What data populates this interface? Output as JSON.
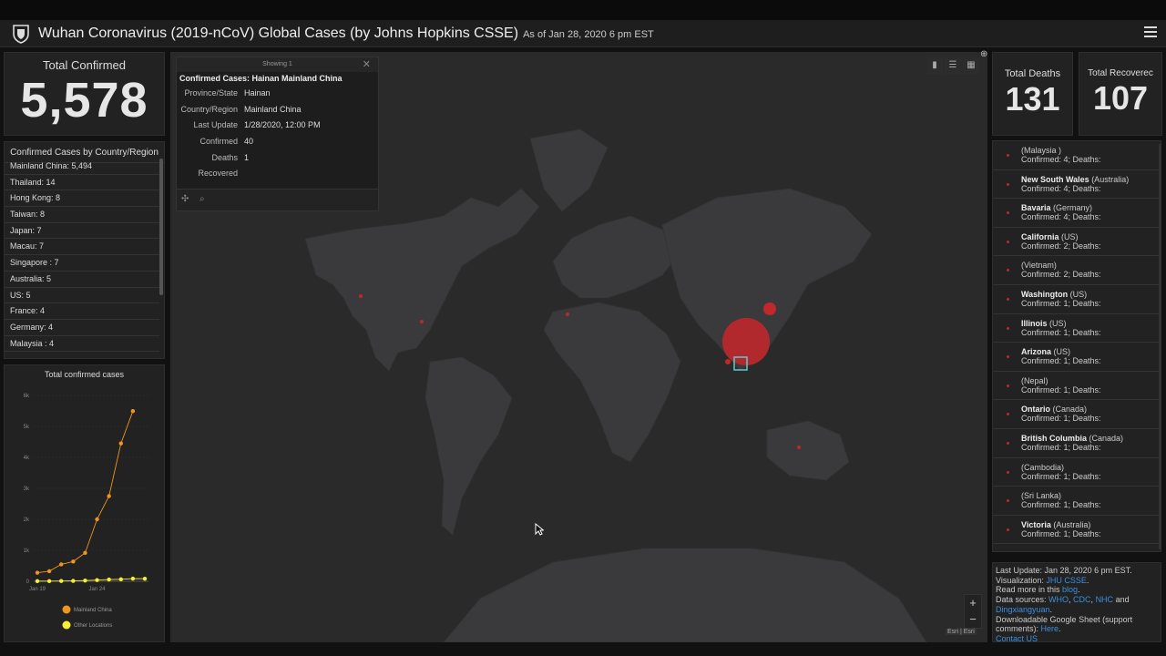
{
  "header": {
    "title": "Wuhan Coronavirus (2019-nCoV) Global Cases (by Johns Hopkins CSSE)",
    "as_of": "As of Jan 28, 2020 6 pm EST"
  },
  "total_confirmed": {
    "label": "Total Confirmed",
    "value": "5,578"
  },
  "country_list": {
    "title": "Confirmed Cases by Country/Region",
    "rows": [
      "Mainland China:  5,494",
      "Thailand:  14",
      "Hong Kong:  8",
      "Taiwan:  8",
      "Japan:  7",
      "Macau:  7",
      "Singapore :  7",
      "Australia:  5",
      "US:  5",
      "France:  4",
      "Germany:  4",
      "Malaysia :  4"
    ]
  },
  "popup": {
    "showing": "Showing 1",
    "title": "Confirmed Cases: Hainan Mainland China",
    "rows": [
      {
        "key": "Province/State",
        "value": "Hainan"
      },
      {
        "key": "Country/Region",
        "value": "Mainland China"
      },
      {
        "key": "Last Update",
        "value": "1/28/2020, 12:00 PM"
      },
      {
        "key": "Confirmed",
        "value": "40"
      },
      {
        "key": "Deaths",
        "value": "1"
      },
      {
        "key": "Recovered",
        "value": ""
      }
    ]
  },
  "map": {
    "zoom_in": "+",
    "zoom_out": "−",
    "attribution": "Esri | Esri"
  },
  "deaths": {
    "label": "Total Deaths",
    "value": "131"
  },
  "recovered": {
    "label": "Total Recoverec",
    "value": "107"
  },
  "locations": [
    {
      "name": "",
      "region": "(Malaysia )",
      "detail": "Confirmed: 4; Deaths:"
    },
    {
      "name": "New South Wales",
      "region": " (Australia)",
      "detail": "Confirmed: 4; Deaths:"
    },
    {
      "name": "Bavaria",
      "region": " (Germany)",
      "detail": "Confirmed: 4; Deaths:"
    },
    {
      "name": "California",
      "region": " (US)",
      "detail": "Confirmed: 2; Deaths:"
    },
    {
      "name": "",
      "region": "(Vietnam)",
      "detail": "Confirmed: 2; Deaths:"
    },
    {
      "name": "Washington",
      "region": " (US)",
      "detail": "Confirmed: 1; Deaths:"
    },
    {
      "name": "Illinois",
      "region": " (US)",
      "detail": "Confirmed: 1; Deaths:"
    },
    {
      "name": "Arizona",
      "region": " (US)",
      "detail": "Confirmed: 1; Deaths:"
    },
    {
      "name": "",
      "region": "(Nepal)",
      "detail": "Confirmed: 1; Deaths:"
    },
    {
      "name": "Ontario",
      "region": " (Canada)",
      "detail": "Confirmed: 1; Deaths:"
    },
    {
      "name": "British Columbia",
      "region": " (Canada)",
      "detail": "Confirmed: 1; Deaths:"
    },
    {
      "name": "",
      "region": "(Cambodia)",
      "detail": "Confirmed: 1; Deaths:"
    },
    {
      "name": "",
      "region": "(Sri Lanka)",
      "detail": "Confirmed: 1; Deaths:"
    },
    {
      "name": "Victoria",
      "region": " (Australia)",
      "detail": "Confirmed: 1; Deaths:"
    }
  ],
  "info": {
    "last_update": "Last Update: Jan 28, 2020 6 pm EST.",
    "viz_prefix": "Visualization: ",
    "viz_link": "JHU CSSE",
    "viz_suffix": ".",
    "read_prefix": "Read more in this ",
    "read_link": "blog",
    "read_suffix": ".",
    "sources_prefix": "Data sources: ",
    "src_who": "WHO",
    "src_sep1": ", ",
    "src_cdc": "CDC",
    "src_sep2": ", ",
    "src_nhc": "NHC",
    "src_and": " and",
    "src_ding": "Dingxiangyuan",
    "src_end": ".",
    "sheet_prefix": "Downloadable Google Sheet (support comments): ",
    "sheet_link": "Here",
    "sheet_suffix": ".",
    "contact": "Contact US"
  },
  "colors": {
    "mainland": "#f0961f",
    "other": "#f6ef38",
    "case_marker": "#c0282b",
    "link": "#3b8fe0"
  },
  "chart_data": {
    "type": "line",
    "title": "Total confirmed cases",
    "x": [
      "Jan 19",
      "Jan 20",
      "Jan 21",
      "Jan 22",
      "Jan 23",
      "Jan 24",
      "Jan 25",
      "Jan 26",
      "Jan 27",
      "Jan 28"
    ],
    "xtick_labels": [
      "Jan 19",
      "Jan 24"
    ],
    "yticks": [
      0,
      1000,
      2000,
      3000,
      4000,
      5000,
      6000
    ],
    "ytick_labels": [
      "0",
      "1k",
      "2k",
      "3k",
      "4k",
      "5k",
      "6k"
    ],
    "ylim": [
      0,
      6000
    ],
    "legend_position": "bottom",
    "series": [
      {
        "name": "Mainland China",
        "values": [
          278,
          326,
          547,
          639,
          916,
          2000,
          2750,
          4450,
          5494
        ]
      },
      {
        "name": "Other Locations",
        "values": [
          4,
          6,
          8,
          14,
          25,
          40,
          57,
          64,
          87,
          84
        ]
      }
    ]
  }
}
